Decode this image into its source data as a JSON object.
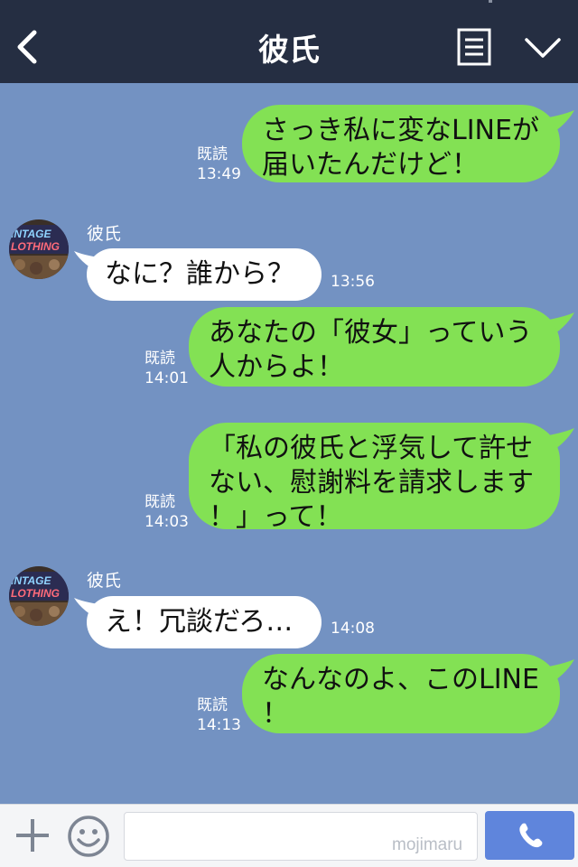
{
  "header": {
    "title": "彼氏",
    "back_icon": "chevron-left-icon",
    "menu_icon": "document-lines-icon",
    "expand_icon": "chevron-down-icon"
  },
  "colors": {
    "header_bg": "#252e42",
    "chat_bg": "#7392c2",
    "sent_bubble": "#83e154",
    "recv_bubble": "#ffffff",
    "call_button": "#5f85dc"
  },
  "messages": [
    {
      "direction": "sent",
      "lines": [
        "さっき私に変なLINEが",
        "届いたんだけど！"
      ],
      "read": "既読",
      "time": "13:49"
    },
    {
      "direction": "received",
      "sender": "彼氏",
      "avatar_text": [
        "INTAGE",
        "LOTHING"
      ],
      "lines": [
        "なに？誰から？"
      ],
      "time": "13:56"
    },
    {
      "direction": "sent",
      "lines": [
        "あなたの「彼女」っていう",
        "人からよ！"
      ],
      "read": "既読",
      "time": "14:01"
    },
    {
      "direction": "sent",
      "lines": [
        "「私の彼氏と浮気して許せ",
        "ない、慰謝料を請求します",
        "！」って！"
      ],
      "read": "既読",
      "time": "14:03"
    },
    {
      "direction": "received",
      "sender": "彼氏",
      "avatar_text": [
        "INTAGE",
        "LOTHING"
      ],
      "lines": [
        "え！冗談だろ…"
      ],
      "time": "14:08"
    },
    {
      "direction": "sent",
      "lines": [
        "なんなのよ、このLINE",
        "！"
      ],
      "read": "既読",
      "time": "14:13"
    }
  ],
  "footer": {
    "plus_icon": "plus-icon",
    "emoji_icon": "smiley-icon",
    "input_value": "",
    "watermark": "mojimaru",
    "call_icon": "phone-icon"
  }
}
